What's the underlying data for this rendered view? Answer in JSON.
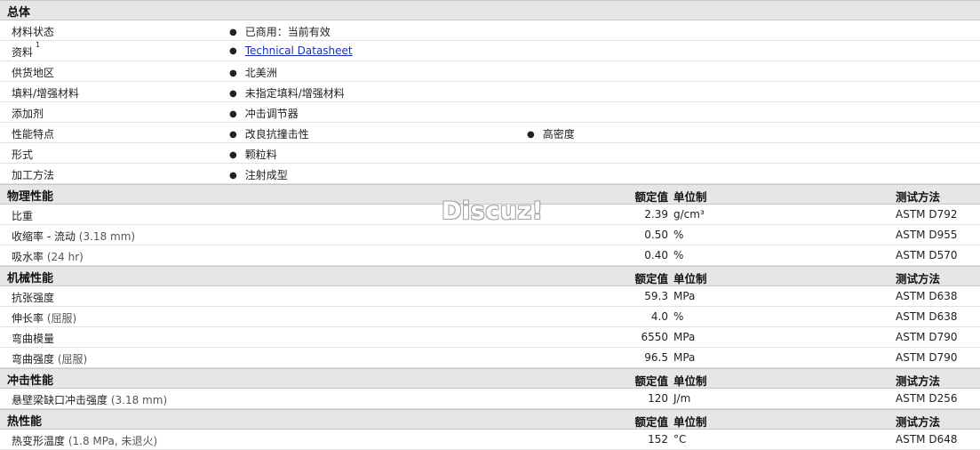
{
  "general": {
    "title": "总体",
    "rows": [
      {
        "label": "材料状态",
        "values": [
          "已商用：当前有效"
        ]
      },
      {
        "label": "资料",
        "sup": "1",
        "link": "Technical Datasheet"
      },
      {
        "label": "供货地区",
        "values": [
          "北美洲"
        ]
      },
      {
        "label": "填料/增强材料",
        "values": [
          "未指定填料/增强材料"
        ]
      },
      {
        "label": "添加剂",
        "values": [
          "冲击调节器"
        ]
      },
      {
        "label": "性能特点",
        "values": [
          "改良抗撞击性",
          "高密度"
        ]
      },
      {
        "label": "形式",
        "values": [
          "颗粒料"
        ]
      },
      {
        "label": "加工方法",
        "values": [
          "注射成型"
        ]
      }
    ]
  },
  "column_headers": {
    "nominal": "额定值",
    "unit": "单位制",
    "test": "测试方法"
  },
  "sections": [
    {
      "title": "物理性能",
      "rows": [
        {
          "label": "比重",
          "note": "",
          "value": "2.39",
          "unit": "g/cm³",
          "test": "ASTM D792"
        },
        {
          "label": "收缩率 - 流动",
          "note": "(3.18 mm)",
          "value": "0.50",
          "unit": "%",
          "test": "ASTM D955"
        },
        {
          "label": "吸水率",
          "note": "(24 hr)",
          "value": "0.40",
          "unit": "%",
          "test": "ASTM D570"
        }
      ]
    },
    {
      "title": "机械性能",
      "rows": [
        {
          "label": "抗张强度",
          "note": "",
          "value": "59.3",
          "unit": "MPa",
          "test": "ASTM D638"
        },
        {
          "label": "伸长率",
          "note": "(屈服)",
          "value": "4.0",
          "unit": "%",
          "test": "ASTM D638"
        },
        {
          "label": "弯曲模量",
          "note": "",
          "value": "6550",
          "unit": "MPa",
          "test": "ASTM D790"
        },
        {
          "label": "弯曲强度",
          "note": "(屈服)",
          "value": "96.5",
          "unit": "MPa",
          "test": "ASTM D790"
        }
      ]
    },
    {
      "title": "冲击性能",
      "rows": [
        {
          "label": "悬壁梁缺口冲击强度",
          "note": "(3.18 mm)",
          "value": "120",
          "unit": "J/m",
          "test": "ASTM D256"
        }
      ]
    },
    {
      "title": "热性能",
      "rows": [
        {
          "label": "热变形温度",
          "note": "(1.8 MPa, 未退火)",
          "value": "152",
          "unit": "°C",
          "test": "ASTM D648"
        }
      ]
    }
  ],
  "watermark": "Discuz!",
  "bullet": "●"
}
